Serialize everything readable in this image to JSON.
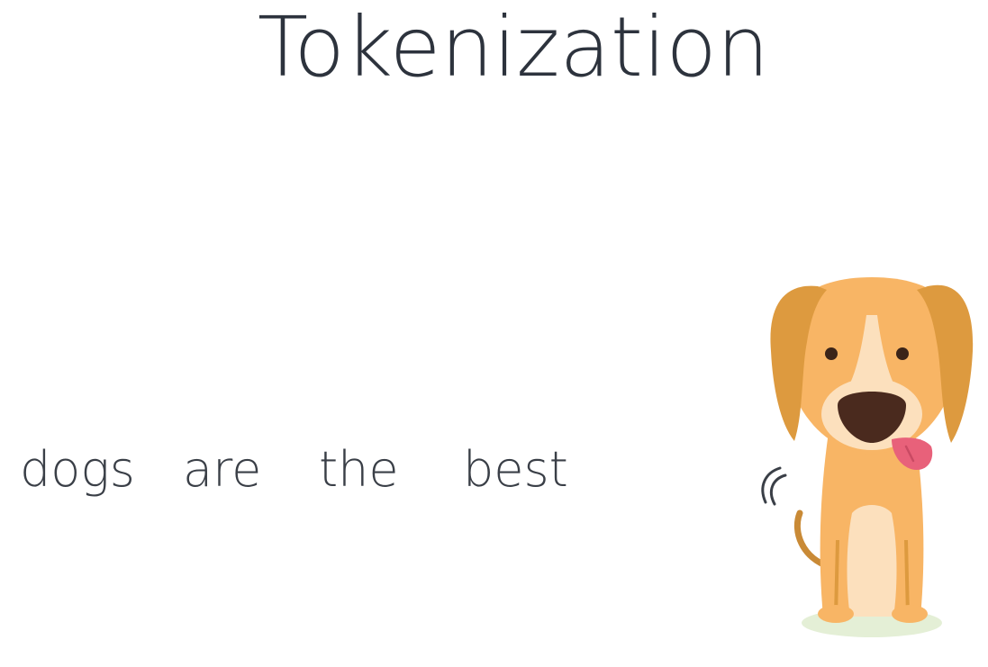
{
  "slide": {
    "title": "Tokenization",
    "tokens": [
      "dogs",
      "are",
      "the",
      "best"
    ]
  },
  "illustration": {
    "icon": "dog-icon",
    "colors": {
      "fur": "#f8b565",
      "ears": "#dd9a3f",
      "muzzle": "#fce0bd",
      "nose": "#4a2a1e",
      "tongue": "#e8617a",
      "shadow": "#e4efd6"
    }
  }
}
